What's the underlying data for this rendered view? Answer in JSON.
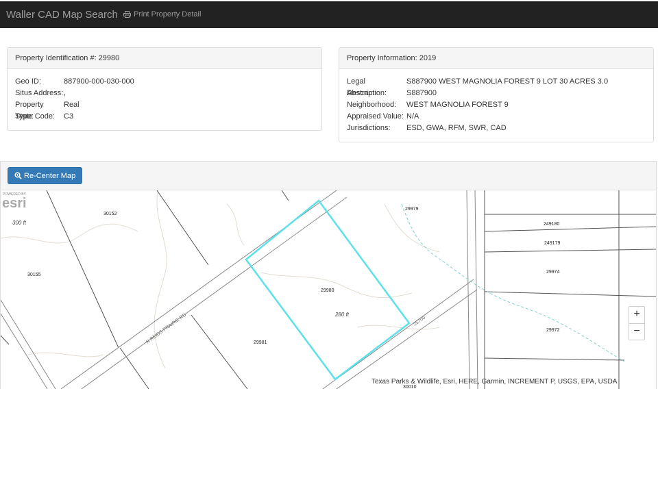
{
  "navbar": {
    "brand": "Waller CAD Map Search",
    "print_label": "Print Property Detail"
  },
  "identification": {
    "heading": "Property Identification #: 29980",
    "rows": [
      {
        "label": "Geo ID:",
        "value": "887900-000-030-000"
      },
      {
        "label": "Situs Address:",
        "value": ","
      },
      {
        "label": "Property Type:",
        "value": "Real"
      },
      {
        "label": "State Code:",
        "value": "C3"
      }
    ]
  },
  "information": {
    "heading": "Property Information: 2019",
    "rows": [
      {
        "label": "Legal Description:",
        "value": "S887900 WEST MAGNOLIA FOREST 9 LOT 30 ACRES 3.0"
      },
      {
        "label": "Abstract:",
        "value": "S887900"
      },
      {
        "label": "Neighborhood:",
        "value": "WEST MAGNOLIA FOREST 9"
      },
      {
        "label": "Appraised Value:",
        "value": "N/A"
      },
      {
        "label": "Jurisdictions:",
        "value": "ESD, GWA, RFM, SWR, CAD"
      }
    ]
  },
  "map": {
    "recenter_label": "Re-Center Map",
    "zoom_in": "+",
    "zoom_out": "−",
    "attribution": "Texas Parks & Wildlife, Esri, HERE, Garmin, INCREMENT P, USGS, EPA, USDA",
    "esri_powered": "POWERED BY",
    "esri_logo": "esri",
    "highlight_color": "#5ce0ea",
    "parcel_labels": {
      "p30152": "30152",
      "p30155": "30155",
      "p29979": "29979",
      "p249180": "249180",
      "p249179": "249179",
      "p29974": "29974",
      "p29980": "29980",
      "p29981": "29981",
      "p29972": "29972",
      "p30010": "30010"
    },
    "dimension_labels": {
      "d300": "300 ft",
      "d280": "280 ft"
    },
    "road_labels": {
      "reids": "N REIDS PRAIRIE RD",
      "r25700": "25700"
    }
  }
}
